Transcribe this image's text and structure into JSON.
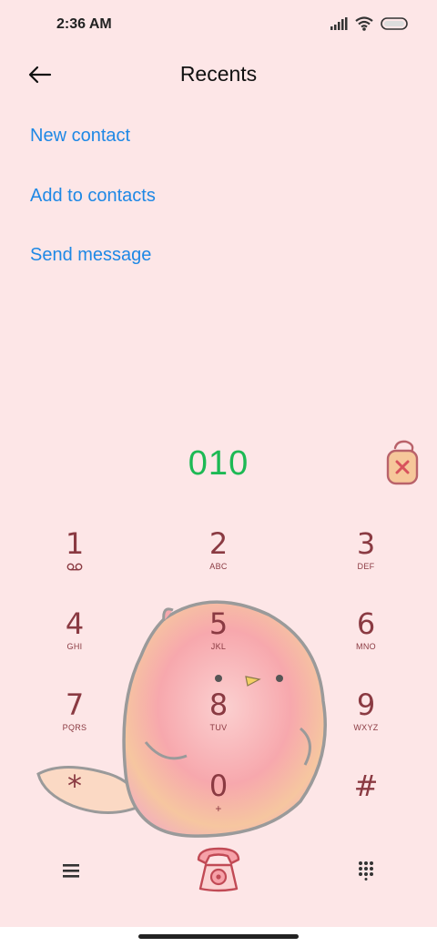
{
  "status_bar": {
    "time": "2:36 AM",
    "icons": [
      "signal-icon",
      "wifi-icon",
      "battery-icon"
    ]
  },
  "header": {
    "title": "Recents",
    "back_icon": "arrow-left-icon"
  },
  "actions": {
    "new_contact": "New contact",
    "add_to_contacts": "Add to contacts",
    "send_message": "Send message"
  },
  "dialer": {
    "number": "010",
    "delete_icon": "backspace-icon"
  },
  "keypad": {
    "keys": [
      {
        "digit": "1",
        "letters": "",
        "sub_icon": "voicemail-icon"
      },
      {
        "digit": "2",
        "letters": "ABC"
      },
      {
        "digit": "3",
        "letters": "DEF"
      },
      {
        "digit": "4",
        "letters": "GHI"
      },
      {
        "digit": "5",
        "letters": "JKL"
      },
      {
        "digit": "6",
        "letters": "MNO"
      },
      {
        "digit": "7",
        "letters": "PQRS"
      },
      {
        "digit": "8",
        "letters": "TUV"
      },
      {
        "digit": "9",
        "letters": "WXYZ"
      },
      {
        "digit": "*",
        "letters": ""
      },
      {
        "digit": "0",
        "letters": "+"
      },
      {
        "digit": "#",
        "letters": ""
      }
    ]
  },
  "bottom_bar": {
    "menu_icon": "menu-icon",
    "call_icon": "phone-call-icon",
    "keypad_icon": "dialpad-icon"
  },
  "colors": {
    "background": "#fde6e7",
    "link": "#1e88e5",
    "number": "#1db954",
    "key": "#8a3a42"
  }
}
